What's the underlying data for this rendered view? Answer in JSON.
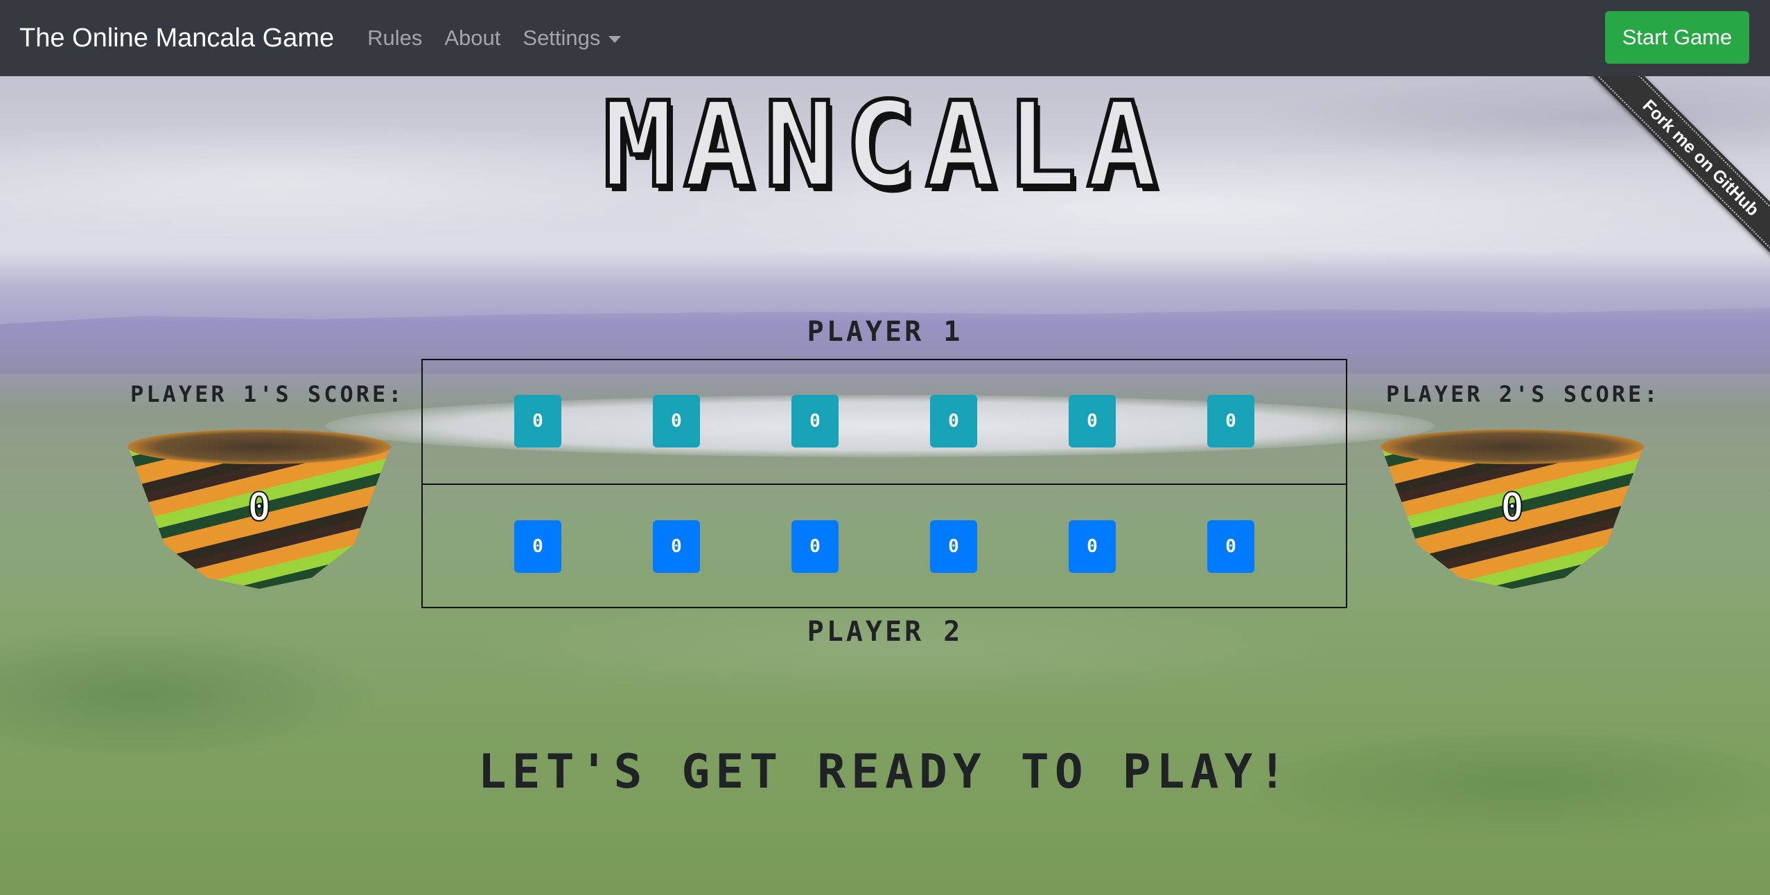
{
  "navbar": {
    "brand": "The Online Mancala Game",
    "links": [
      "Rules",
      "About",
      "Settings"
    ],
    "start_button": "Start Game"
  },
  "ribbon": {
    "label": "Fork me on GitHub"
  },
  "game": {
    "title": "MANCALA",
    "player1_label": "PLAYER 1",
    "player2_label": "PLAYER 2",
    "player1_score_label": "PLAYER 1'S SCORE:",
    "player2_score_label": "PLAYER 2'S SCORE:",
    "player1_store": "0",
    "player2_store": "0",
    "player1_pits": [
      "0",
      "0",
      "0",
      "0",
      "0",
      "0"
    ],
    "player2_pits": [
      "0",
      "0",
      "0",
      "0",
      "0",
      "0"
    ],
    "status": "LET'S GET READY TO PLAY!"
  },
  "colors": {
    "navbar": "#343a40",
    "start_button": "#28a745",
    "player1_pit": "#17a2b8",
    "player2_pit": "#007bff"
  }
}
